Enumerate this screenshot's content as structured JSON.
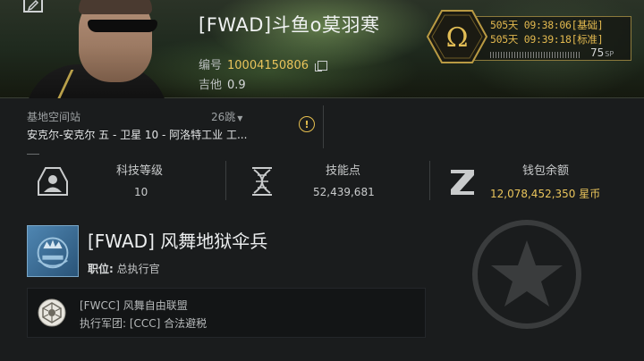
{
  "character": {
    "name": "[FWAD]斗鱼o莫羽寒",
    "id_label": "编号",
    "id_value": "10004150806",
    "sec_label": "吉他",
    "sec_value": "0.9"
  },
  "skill_queue": {
    "line1": "505天 09:38:06[基础]",
    "line2": "505天 09:39:18[标准]",
    "sp_value": "75",
    "sp_unit": "SP"
  },
  "home_station": {
    "label": "基地空间站",
    "jumps": "26跳",
    "name": "安克尔-安克尔 五 - 卫星 10 - 阿洛特工业 工..."
  },
  "stats": {
    "tech": {
      "title": "科技等级",
      "value": "10"
    },
    "skill_points": {
      "title": "技能点",
      "value": "52,439,681"
    },
    "wallet": {
      "title": "钱包余额",
      "value": "12,078,452,350 星币"
    }
  },
  "corporation": {
    "name": "[FWAD] 风舞地狱伞兵",
    "role_label": "职位:",
    "role_value": "总执行官"
  },
  "alliance": {
    "name": "[FWCC] 风舞自由联盟",
    "faction": "执行军团: [CCC] 合法避税"
  },
  "colors": {
    "gold": "#e9c45b",
    "text": "#d6d8da",
    "background": "#1a1c1d"
  },
  "icons": [
    "edit-icon",
    "copy-icon",
    "omega-icon",
    "warning-icon",
    "tech-level-icon",
    "skill-points-icon",
    "wallet-icon",
    "corp-logo",
    "alliance-logo"
  ]
}
